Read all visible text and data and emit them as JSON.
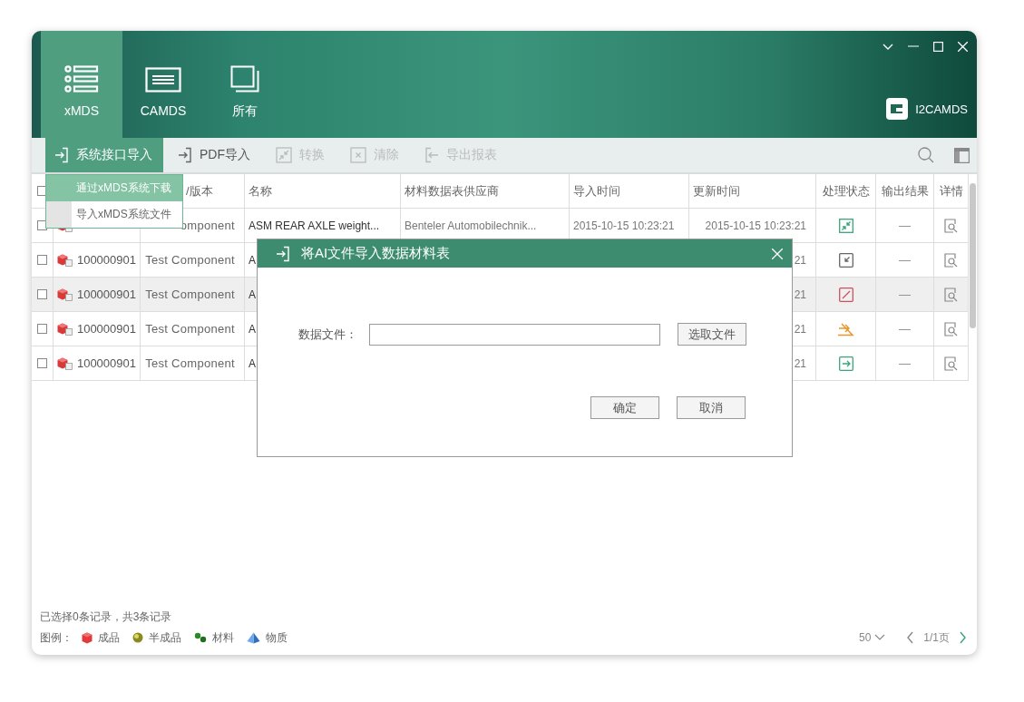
{
  "nav_tabs": [
    {
      "label": "xMDS",
      "kind": "list",
      "selected": true
    },
    {
      "label": "CAMDS",
      "kind": "screen",
      "selected": false
    },
    {
      "label": "所有",
      "kind": "stack",
      "selected": false
    }
  ],
  "logo": {
    "label": "I2CAMDS"
  },
  "toolbar": [
    {
      "label": "系统接口导入",
      "kind": "enter",
      "expanded": true,
      "disabled": false
    },
    {
      "label": "PDF导入",
      "kind": "enter",
      "expanded": false,
      "disabled": false
    },
    {
      "label": "转换",
      "kind": "shrink",
      "expanded": false,
      "disabled": true
    },
    {
      "label": "清除",
      "kind": "clear",
      "expanded": false,
      "disabled": true
    },
    {
      "label": "导出报表",
      "kind": "exit",
      "expanded": false,
      "disabled": true
    }
  ],
  "import_menu": [
    {
      "label": "通过xMDS系统下载",
      "selected": true
    },
    {
      "label": "导入xMDS系统文件",
      "selected": false
    }
  ],
  "table": {
    "header_checked": false,
    "columns": [
      "/版本",
      "名称",
      "材料数据表供应商",
      "导入时间",
      "更新时间",
      "处理状态",
      "输出结果",
      "详情"
    ],
    "rows": [
      {
        "checked": false,
        "selected": false,
        "version": "omponent",
        "name": "ASM REAR AXLE weight...",
        "supplier": "Benteler Automobilechnik...",
        "import_time": "2015-10-15 10:23:21",
        "update_time": "2015-10-15 10:23:21",
        "status": {
          "kind": "shrink"
        },
        "output": "—"
      },
      {
        "checked": false,
        "selected": false,
        "id": "100000901",
        "version": "Test Component",
        "name": "A",
        "update_time": "21",
        "status": {
          "kind": "pending"
        },
        "output": "—"
      },
      {
        "checked": false,
        "selected": true,
        "id": "100000901",
        "version": "Test Component",
        "name": "A",
        "update_time": "21",
        "status": {
          "kind": "failed"
        },
        "output": "—"
      },
      {
        "checked": false,
        "selected": false,
        "id": "100000901",
        "version": "Test Component",
        "name": "A",
        "update_time": "21",
        "status": {
          "kind": "processing"
        },
        "output": "—"
      },
      {
        "checked": false,
        "selected": false,
        "id": "100000901",
        "version": "Test Component",
        "name": "A",
        "update_time": "21",
        "status": {
          "kind": "done"
        },
        "output": "—"
      }
    ]
  },
  "dialog": {
    "title": "将AI文件导入数据材料表",
    "field_label": "数据文件：",
    "browse_button": "选取文件",
    "buttons": [
      "确定",
      "取消"
    ]
  },
  "status_bar": {
    "selection": "已选择0条记录，共3条记录",
    "legend_label": "图例：",
    "legend": [
      {
        "label": "成品",
        "kind": "product"
      },
      {
        "label": "半成品",
        "kind": "semi"
      },
      {
        "label": "材料",
        "kind": "material"
      },
      {
        "label": "物质",
        "kind": "substance"
      }
    ],
    "page_size": "50",
    "page": "1/1页"
  }
}
